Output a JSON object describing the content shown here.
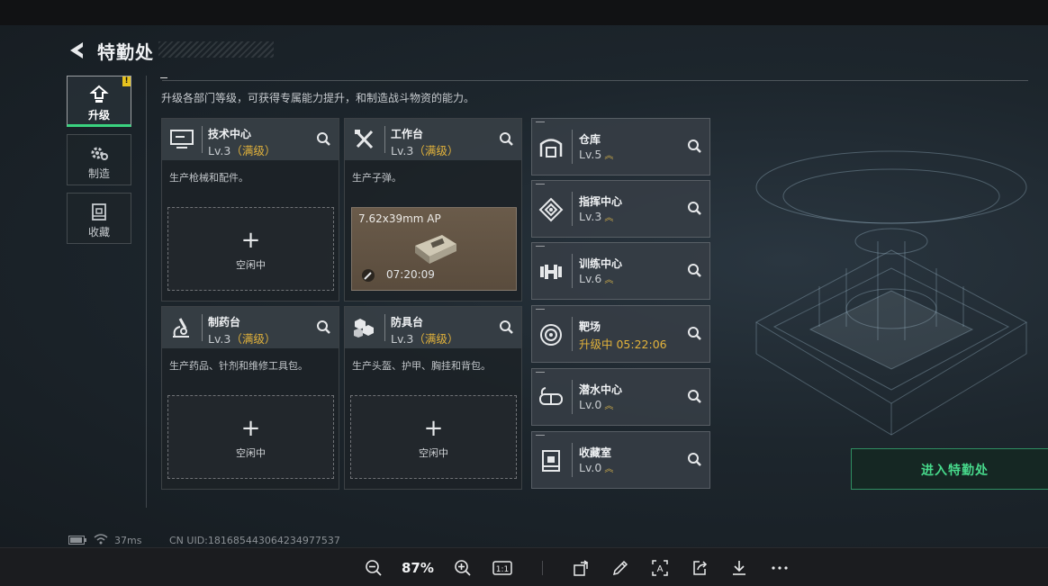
{
  "header": {
    "title": "特勤处",
    "description": "升级各部门等级，可获得专属能力提升，和制造战斗物资的能力。"
  },
  "nav": [
    {
      "label": "升级",
      "active": true,
      "badge": "!"
    },
    {
      "label": "制造",
      "active": false
    },
    {
      "label": "收藏",
      "active": false
    }
  ],
  "cards": [
    {
      "name": "技术中心",
      "level": "Lv.3",
      "status": "（满级）",
      "desc": "生产枪械和配件。",
      "slot": "空闲中"
    },
    {
      "name": "工作台",
      "level": "Lv.3",
      "status": "（满级）",
      "desc": "生产子弹。",
      "craft": {
        "item": "7.62x39mm AP",
        "timer": "07:20:09"
      }
    },
    {
      "name": "制药台",
      "level": "Lv.3",
      "status": "（满级）",
      "desc": "生产药品、针剂和维修工具包。",
      "slot": "空闲中"
    },
    {
      "name": "防具台",
      "level": "Lv.3",
      "status": "（满级）",
      "desc": "生产头盔、护甲、胸挂和背包。",
      "slot": "空闲中"
    }
  ],
  "departments": [
    {
      "name": "仓库",
      "level": "Lv.5",
      "icon": "warehouse-icon"
    },
    {
      "name": "指挥中心",
      "level": "Lv.3",
      "icon": "command-icon"
    },
    {
      "name": "训练中心",
      "level": "Lv.6",
      "icon": "dumbbell-icon"
    },
    {
      "name": "靶场",
      "level": "升级中 05:22:06",
      "icon": "target-icon",
      "upgrading": true
    },
    {
      "name": "潜水中心",
      "level": "Lv.0",
      "icon": "diving-mask-icon"
    },
    {
      "name": "收藏室",
      "level": "Lv.0",
      "icon": "collection-icon"
    }
  ],
  "enter_button": "进入特勤处",
  "status": {
    "ping": "37ms",
    "uid": "CN UID:181685443064234977537"
  },
  "viewer": {
    "zoom": "87%"
  },
  "colors": {
    "accent_green": "#3ad27f",
    "maxed_gold": "#e3b33b"
  }
}
